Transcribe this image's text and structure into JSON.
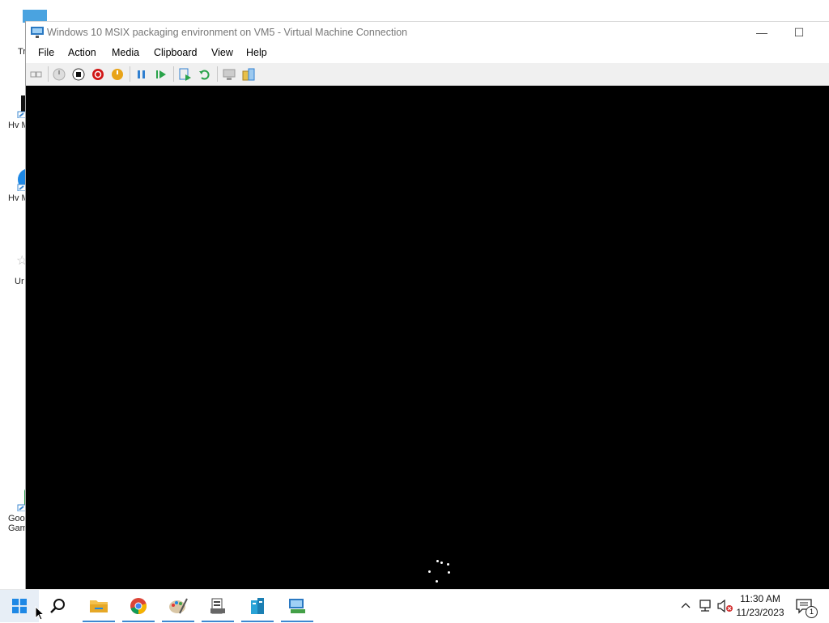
{
  "window": {
    "title": "Windows 10 MSIX packaging environment on VM5 - Virtual Machine Connection",
    "minimize_glyph": "—",
    "maximize_glyph": "☐"
  },
  "menu": {
    "file": "File",
    "action": "Action",
    "media": "Media",
    "clipboard": "Clipboard",
    "view": "View",
    "help": "Help"
  },
  "toolbar": {
    "icons": [
      "ctrl-alt-del-icon",
      "start-icon",
      "turn-off-icon",
      "shut-down-icon",
      "save-icon",
      "pause-icon",
      "resume-icon",
      "checkpoint-icon",
      "revert-icon",
      "enhanced-session-icon",
      "share-icon"
    ]
  },
  "desktop": {
    "icons": [
      {
        "label": "Tr",
        "name": "desktop-icon-tr"
      },
      {
        "label": "Hv M",
        "name": "desktop-icon-hv-1"
      },
      {
        "label": "Hv M",
        "name": "desktop-icon-hv-2"
      },
      {
        "label": "Ur",
        "name": "desktop-icon-ur"
      },
      {
        "label": "Goo",
        "label2": "Gam",
        "name": "desktop-icon-google-games"
      }
    ]
  },
  "taskbar": {
    "apps": [
      "start-button",
      "search-button",
      "file-explorer",
      "chrome",
      "paint",
      "app-server",
      "app-buildings",
      "app-hyperv"
    ],
    "clock_time": "11:30 AM",
    "clock_date": "11/23/2023",
    "notification_count": "1"
  },
  "colors": {
    "accent": "#3c88d1",
    "vm_screen": "#000000"
  }
}
